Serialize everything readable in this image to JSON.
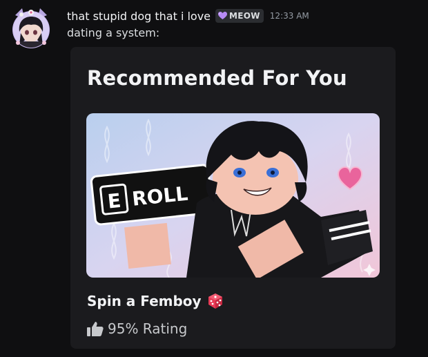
{
  "message": {
    "username": "that stupid dog that i love",
    "tag_label": "MEOW",
    "timestamp": "12:33 AM",
    "text": "dating a system:"
  },
  "embed": {
    "title": "Recommended For You",
    "game_name": "Spin a Femboy",
    "rating": "95% Rating",
    "thumbnail_sign": "ROLL",
    "thumbnail_key": "E"
  },
  "icons": {
    "tag": "purple-heart-icon",
    "game": "dice-icon",
    "rating": "thumbs-up-icon"
  },
  "colors": {
    "background": "#0f0f11",
    "embed": "#1b1b1e",
    "tag_heart": "#b78af5",
    "dice": "#e83a55"
  }
}
